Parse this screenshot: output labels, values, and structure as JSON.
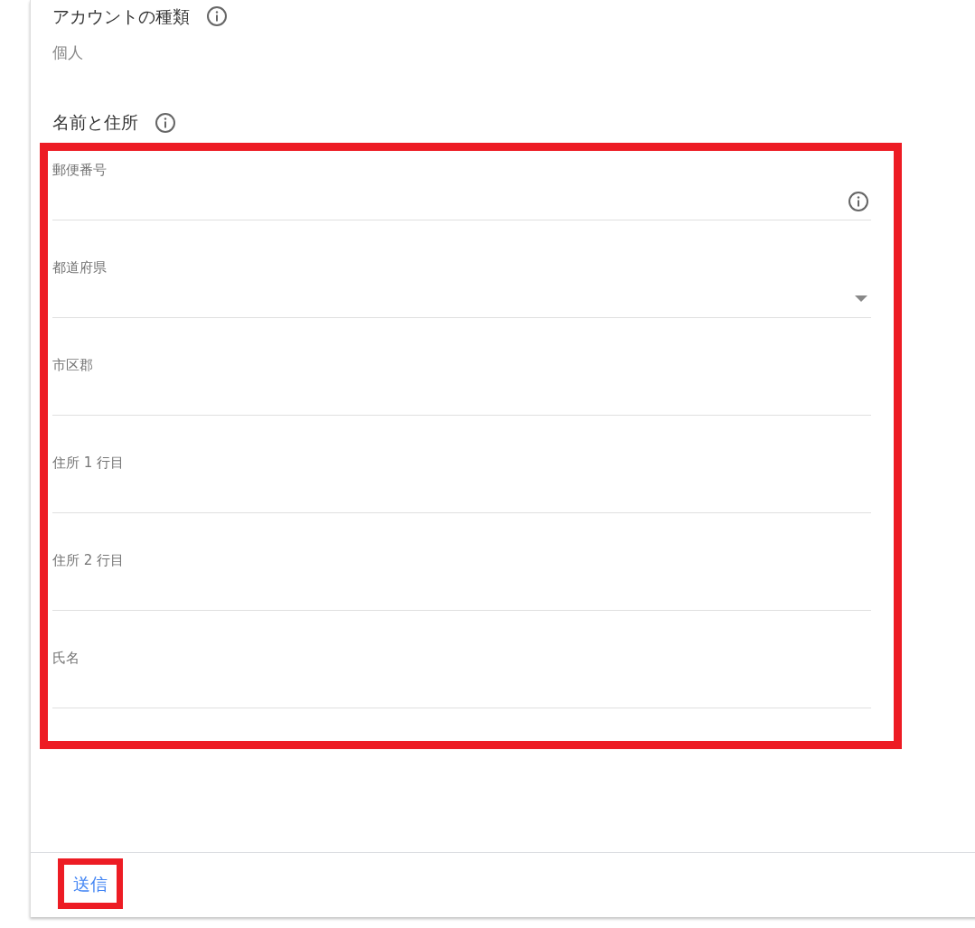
{
  "account_type": {
    "title": "アカウントの種類",
    "value": "個人"
  },
  "name_address": {
    "title": "名前と住所",
    "highlighted": true,
    "fields": [
      {
        "label": "郵便番号",
        "kind": "info"
      },
      {
        "label": "都道府県",
        "kind": "dropdown"
      },
      {
        "label": "市区郡",
        "kind": "text"
      },
      {
        "label": "住所 1 行目",
        "kind": "text"
      },
      {
        "label": "住所 2 行目",
        "kind": "text"
      },
      {
        "label": "氏名",
        "kind": "text"
      }
    ]
  },
  "submit": {
    "label": "送信",
    "highlighted": true
  }
}
